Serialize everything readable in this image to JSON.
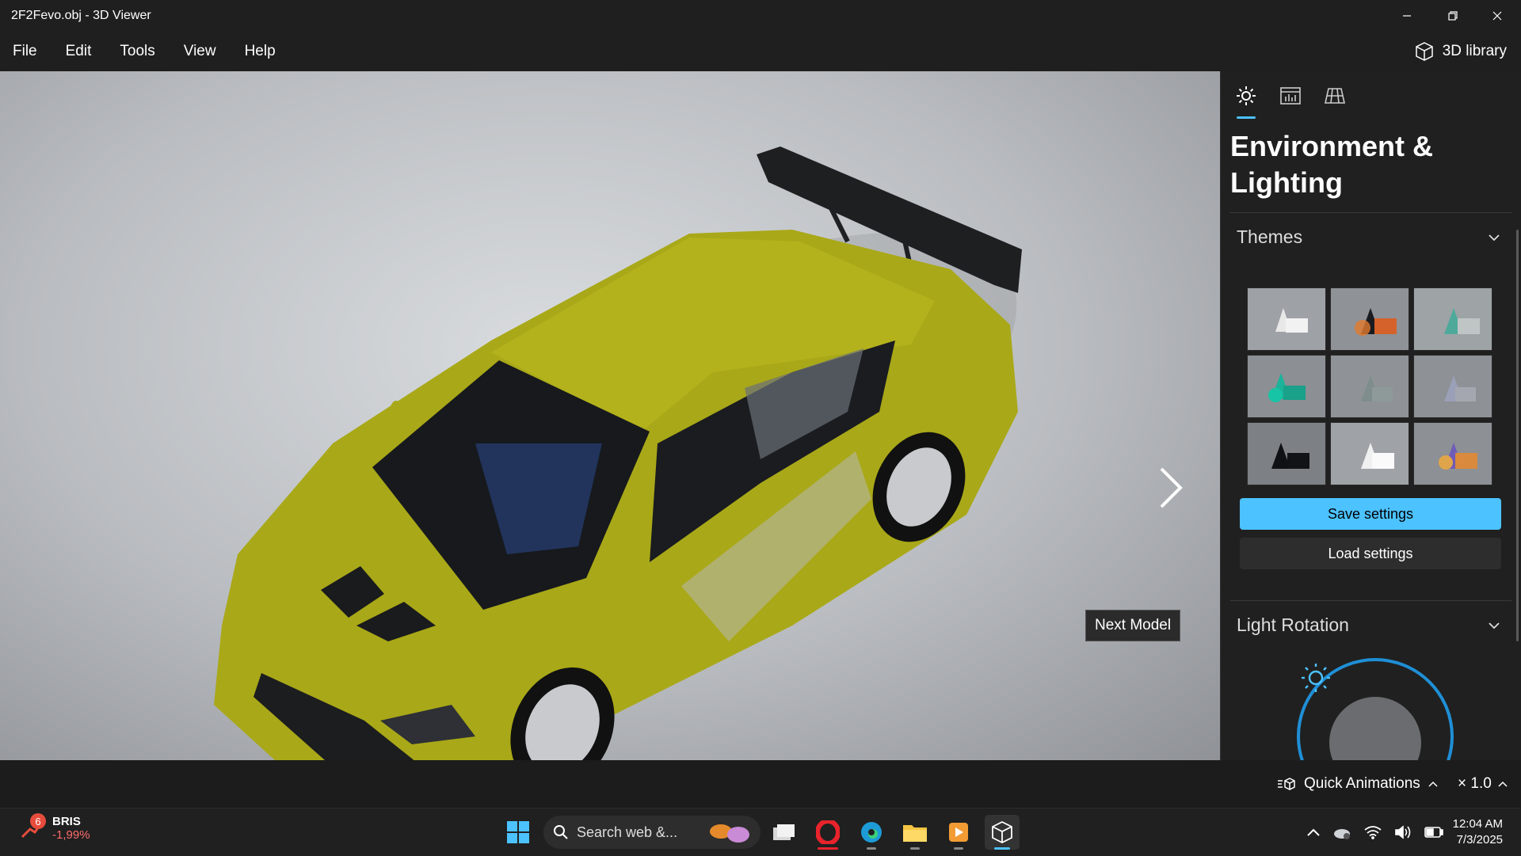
{
  "window": {
    "title": "2F2Fevo.obj - 3D Viewer"
  },
  "menu": {
    "items": [
      "File",
      "Edit",
      "Tools",
      "View",
      "Help"
    ],
    "library_label": "3D library"
  },
  "viewport": {
    "next_tooltip": "Next Model"
  },
  "panel": {
    "tabs": [
      "lighting-tab",
      "stats-tab",
      "grid-tab"
    ],
    "title": "Environment & Lighting",
    "themes_label": "Themes",
    "save_label": "Save settings",
    "load_label": "Load settings",
    "light_rotation_label": "Light Rotation",
    "accent": "#4cc2ff"
  },
  "status": {
    "quick_animations": "Quick Animations",
    "speed": "× 1.0"
  },
  "taskbar": {
    "stock_badge": "6",
    "stock_name": "BRIS",
    "stock_change": "-1,99%",
    "search_placeholder": "Search web &...",
    "time": "12:04 AM",
    "date": "7/3/2025"
  }
}
